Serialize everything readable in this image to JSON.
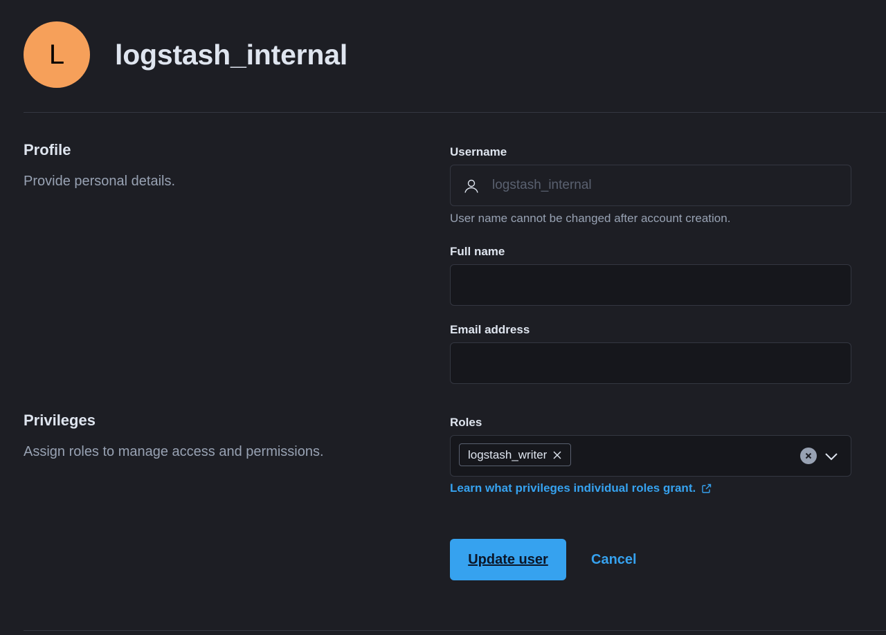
{
  "header": {
    "avatar_initial": "L",
    "avatar_color": "#f6a05a",
    "title": "logstash_internal"
  },
  "profile": {
    "title": "Profile",
    "description": "Provide personal details."
  },
  "privileges": {
    "title": "Privileges",
    "description": "Assign roles to manage access and permissions."
  },
  "form": {
    "username": {
      "label": "Username",
      "value": "logstash_internal",
      "icon": "user-icon",
      "help": "User name cannot be changed after account creation."
    },
    "full_name": {
      "label": "Full name",
      "value": ""
    },
    "email": {
      "label": "Email address",
      "value": ""
    },
    "roles": {
      "label": "Roles",
      "selected": [
        "logstash_writer"
      ],
      "link_text": "Learn what privileges individual roles grant.",
      "link_icon": "external-link-icon"
    }
  },
  "actions": {
    "submit_label": "Update user",
    "cancel_label": "Cancel"
  },
  "colors": {
    "background": "#1d1e24",
    "accent": "#36a2ef",
    "input_bg": "#16171c",
    "border": "#343741"
  }
}
